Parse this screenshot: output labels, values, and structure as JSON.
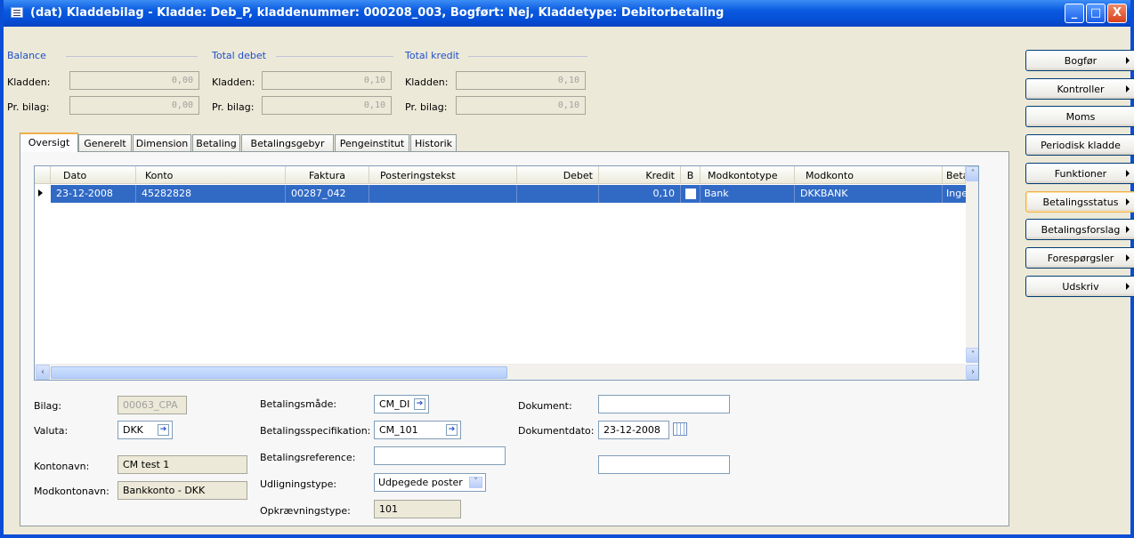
{
  "window": {
    "title": "(dat) Kladdebilag - Kladde: Deb_P, kladdenummer: 000208_003, Bogført: Nej, Kladdetype: Debitorbetaling",
    "min": "_",
    "max": "□",
    "close": "X"
  },
  "totals": {
    "balance": {
      "title": "Balance",
      "kladden_label": "Kladden:",
      "kladden": "0,00",
      "bilag_label": "Pr. bilag:",
      "bilag": "0,00"
    },
    "debet": {
      "title": "Total debet",
      "kladden_label": "Kladden:",
      "kladden": "0,10",
      "bilag_label": "Pr. bilag:",
      "bilag": "0,10"
    },
    "kredit": {
      "title": "Total kredit",
      "kladden_label": "Kladden:",
      "kladden": "0,10",
      "bilag_label": "Pr. bilag:",
      "bilag": "0,10"
    }
  },
  "tabs": [
    "Oversigt",
    "Generelt",
    "Dimension",
    "Betaling",
    "Betalingsgebyr",
    "Pengeinstitut",
    "Historik"
  ],
  "grid": {
    "columns": [
      "Dato",
      "Konto",
      "Faktura",
      "Posteringstekst",
      "Debet",
      "Kredit",
      "B",
      "Modkontotype",
      "Modkonto",
      "Betalin"
    ],
    "rows": [
      {
        "dato": "23-12-2008",
        "konto": "45282828",
        "faktura": "00287_042",
        "tekst": "",
        "debet": "",
        "kredit": "0,10",
        "modkontotype": "Bank",
        "modkonto": "DKKBANK",
        "betaling": "Ingen"
      }
    ]
  },
  "form": {
    "bilag_label": "Bilag:",
    "bilag": "00063_CPA",
    "valuta_label": "Valuta:",
    "valuta": "DKK",
    "kontonavn_label": "Kontonavn:",
    "kontonavn": "CM test 1",
    "modkontonavn_label": "Modkontonavn:",
    "modkontonavn": "Bankkonto - DKK",
    "betalingsmaade_label": "Betalingsmåde:",
    "betalingsmaade": "CM_DI",
    "betalingsspec_label": "Betalingsspecifikation:",
    "betalingsspec": "CM_101",
    "betalingsref_label": "Betalingsreference:",
    "betalingsref": "",
    "udligningstype_label": "Udligningstype:",
    "udligningstype": "Udpegede poster",
    "opkraevningstype_label": "Opkrævningstype:",
    "opkraevningstype": "101",
    "dokument_label": "Dokument:",
    "dokument": "",
    "dokumentdato_label": "Dokumentdato:",
    "dokumentdato": "23-12-2008",
    "extra": ""
  },
  "side_buttons": [
    "Bogfør",
    "Kontroller",
    "Moms",
    "Periodisk kladde",
    "Funktioner",
    "Betalingsstatus",
    "Betalingsforslag",
    "Forespørgsler",
    "Udskriv"
  ]
}
